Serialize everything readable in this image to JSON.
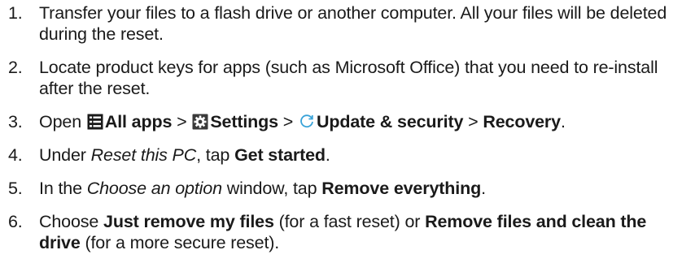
{
  "steps": [
    {
      "number": "1.",
      "text_a": "Transfer your files to a flash drive or another computer. All your files will be deleted during the reset."
    },
    {
      "number": "2.",
      "text_a": "Locate product keys for apps (such as Microsoft Office) that you need to re-install after the reset."
    },
    {
      "number": "3.",
      "open": "Open",
      "all_apps": "All apps",
      "sep1": ">",
      "settings": "Settings",
      "sep2": ">",
      "update_security": "Update & security",
      "sep3": ">",
      "recovery": "Recovery",
      "end": ".",
      "icons": [
        "all-apps-icon",
        "settings-gear-icon",
        "update-refresh-icon"
      ]
    },
    {
      "number": "4.",
      "under": "Under",
      "reset_this_pc": "Reset this PC",
      "tap": ", tap",
      "get_started": "Get started",
      "end": "."
    },
    {
      "number": "5.",
      "in_the": "In the",
      "choose_option": "Choose an option",
      "window_tap": "window, tap",
      "remove_everything": "Remove everything",
      "end": "."
    },
    {
      "number": "6.",
      "choose": "Choose",
      "just_remove": "Just remove my files",
      "fast": "(for a fast reset) or",
      "remove_clean": "Remove files and clean the drive",
      "secure": "(for a more secure reset)."
    }
  ],
  "colors": {
    "text": "#1a1a1a",
    "refresh_icon": "#3aa3d8"
  }
}
